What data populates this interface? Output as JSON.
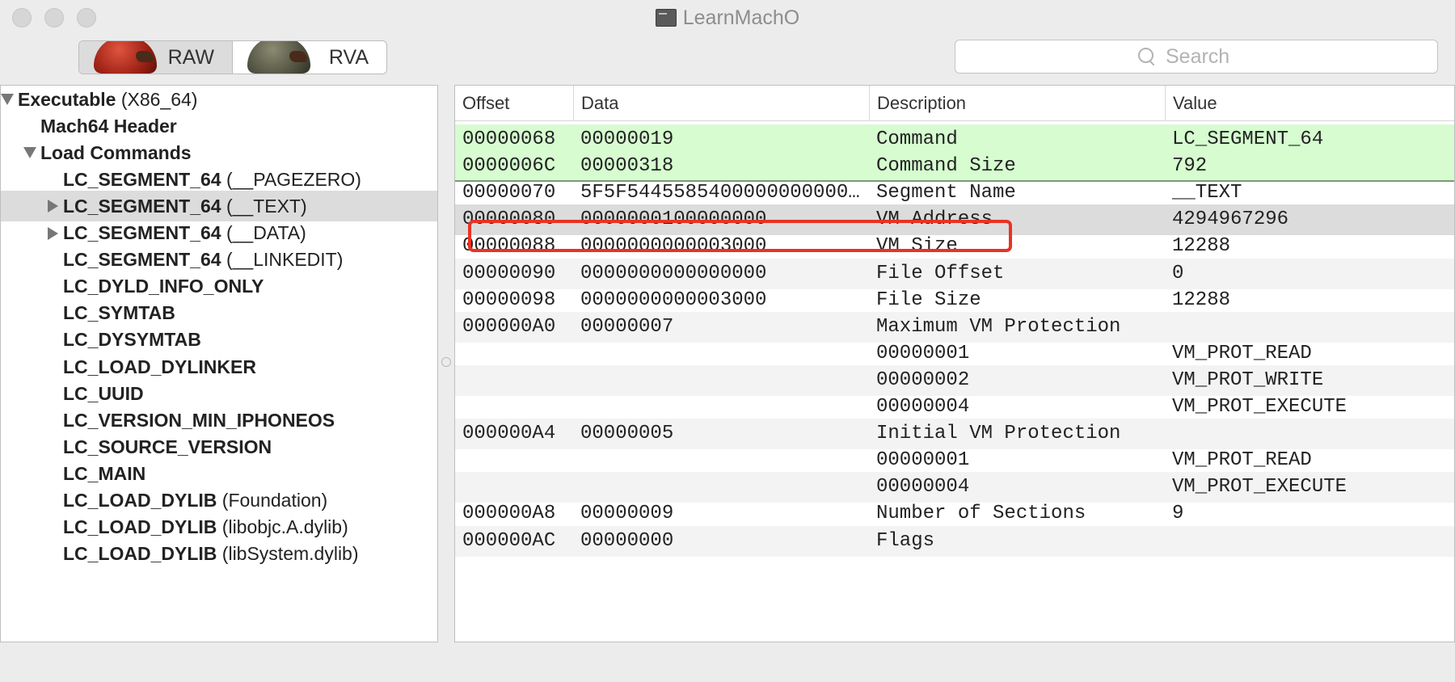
{
  "window": {
    "title": "LearnMachO",
    "app_icon": "terminal-app-icon"
  },
  "toolbar": {
    "mode_options": [
      {
        "label": "RAW",
        "selected": true
      },
      {
        "label": "RVA",
        "selected": false
      }
    ],
    "search": {
      "placeholder": "Search",
      "value": ""
    }
  },
  "sidebar": {
    "items": [
      {
        "label": "Executable",
        "suffix": "(X86_64)",
        "expander": "open"
      },
      {
        "label": "Mach64 Header",
        "suffix": "",
        "expander": "none"
      },
      {
        "label": "Load Commands",
        "suffix": "",
        "expander": "open"
      },
      {
        "label": "LC_SEGMENT_64",
        "suffix": "(__PAGEZERO)",
        "expander": "none"
      },
      {
        "label": "LC_SEGMENT_64",
        "suffix": "(__TEXT)",
        "expander": "closed",
        "selected": true
      },
      {
        "label": "LC_SEGMENT_64",
        "suffix": "(__DATA)",
        "expander": "closed"
      },
      {
        "label": "LC_SEGMENT_64",
        "suffix": "(__LINKEDIT)",
        "expander": "none"
      },
      {
        "label": "LC_DYLD_INFO_ONLY",
        "suffix": "",
        "expander": "none"
      },
      {
        "label": "LC_SYMTAB",
        "suffix": "",
        "expander": "none"
      },
      {
        "label": "LC_DYSYMTAB",
        "suffix": "",
        "expander": "none"
      },
      {
        "label": "LC_LOAD_DYLINKER",
        "suffix": "",
        "expander": "none"
      },
      {
        "label": "LC_UUID",
        "suffix": "",
        "expander": "none"
      },
      {
        "label": "LC_VERSION_MIN_IPHONEOS",
        "suffix": "",
        "expander": "none"
      },
      {
        "label": "LC_SOURCE_VERSION",
        "suffix": "",
        "expander": "none"
      },
      {
        "label": "LC_MAIN",
        "suffix": "",
        "expander": "none"
      },
      {
        "label": "LC_LOAD_DYLIB",
        "suffix": "(Foundation)",
        "expander": "none"
      },
      {
        "label": "LC_LOAD_DYLIB",
        "suffix": "(libobjc.A.dylib)",
        "expander": "none"
      },
      {
        "label": "LC_LOAD_DYLIB",
        "suffix": "(libSystem.dylib)",
        "expander": "none"
      }
    ]
  },
  "table": {
    "columns": [
      "Offset",
      "Data",
      "Description",
      "Value"
    ],
    "rows": [
      {
        "offset": "00000068",
        "data": "00000019",
        "description": "Command",
        "value": "LC_SEGMENT_64",
        "style": "green"
      },
      {
        "offset": "0000006C",
        "data": "00000318",
        "description": "Command Size",
        "value": "792",
        "style": "green"
      },
      {
        "offset": "00000070",
        "data": "5F5F5445585400000000000…",
        "description": "Segment Name",
        "value": "__TEXT",
        "style": ""
      },
      {
        "offset": "00000080",
        "data": "0000000100000000",
        "description": "VM Address",
        "value": "4294967296",
        "style": "selected"
      },
      {
        "offset": "00000088",
        "data": "0000000000003000",
        "description": "VM Size",
        "value": "12288",
        "style": ""
      },
      {
        "offset": "00000090",
        "data": "0000000000000000",
        "description": "File Offset",
        "value": "0",
        "style": "alt"
      },
      {
        "offset": "00000098",
        "data": "0000000000003000",
        "description": "File Size",
        "value": "12288",
        "style": ""
      },
      {
        "offset": "000000A0",
        "data": "00000007",
        "description": "Maximum VM Protection",
        "value": "",
        "style": "alt"
      },
      {
        "offset": "",
        "data": "",
        "description": "00000001",
        "value": "VM_PROT_READ",
        "style": ""
      },
      {
        "offset": "",
        "data": "",
        "description": "00000002",
        "value": "VM_PROT_WRITE",
        "style": "alt"
      },
      {
        "offset": "",
        "data": "",
        "description": "00000004",
        "value": "VM_PROT_EXECUTE",
        "style": ""
      },
      {
        "offset": "000000A4",
        "data": "00000005",
        "description": "Initial VM Protection",
        "value": "",
        "style": "alt"
      },
      {
        "offset": "",
        "data": "",
        "description": "00000001",
        "value": "VM_PROT_READ",
        "style": ""
      },
      {
        "offset": "",
        "data": "",
        "description": "00000004",
        "value": "VM_PROT_EXECUTE",
        "style": "alt"
      },
      {
        "offset": "000000A8",
        "data": "00000009",
        "description": "Number of Sections",
        "value": "9",
        "style": ""
      },
      {
        "offset": "000000AC",
        "data": "00000000",
        "description": "Flags",
        "value": "",
        "style": "alt"
      }
    ]
  },
  "colors": {
    "row_green": "#d6fcd0",
    "row_selected": "#dcdcdc",
    "highlight_box": "#e83323"
  }
}
